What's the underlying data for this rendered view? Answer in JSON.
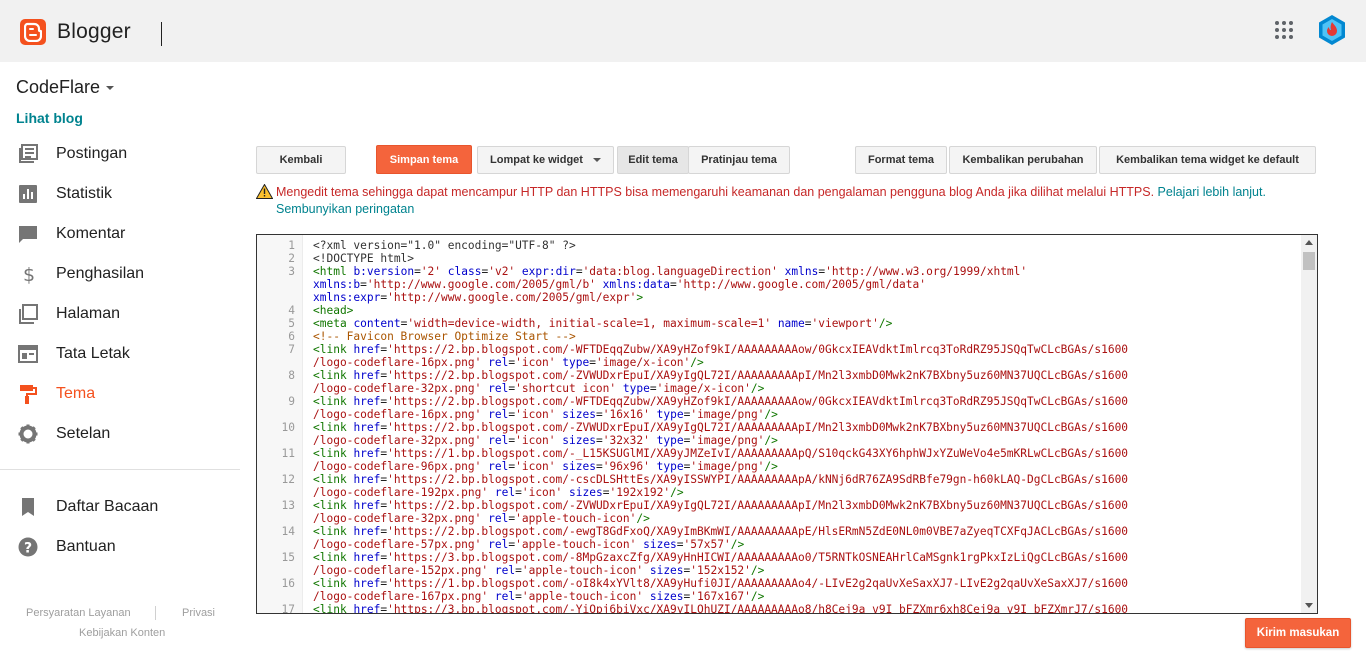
{
  "app": {
    "brand": "Blogger"
  },
  "sidebar": {
    "blog_name": "CodeFlare",
    "view_blog": "Lihat blog",
    "items": [
      {
        "label": "Postingan",
        "icon": "posts-icon"
      },
      {
        "label": "Statistik",
        "icon": "stats-icon"
      },
      {
        "label": "Komentar",
        "icon": "comments-icon"
      },
      {
        "label": "Penghasilan",
        "icon": "dollar-icon"
      },
      {
        "label": "Halaman",
        "icon": "pages-icon"
      },
      {
        "label": "Tata Letak",
        "icon": "layout-icon"
      },
      {
        "label": "Tema",
        "icon": "paint-roller-icon",
        "active": true
      },
      {
        "label": "Setelan",
        "icon": "gear-icon"
      }
    ],
    "items2": [
      {
        "label": "Daftar Bacaan",
        "icon": "bookmark-icon"
      },
      {
        "label": "Bantuan",
        "icon": "help-icon"
      }
    ],
    "footer": {
      "terms": "Persyaratan Layanan",
      "privacy": "Privasi",
      "content_policy": "Kebijakan Konten"
    }
  },
  "toolbar": {
    "back": "Kembali",
    "save": "Simpan tema",
    "jump": "Lompat ke widget",
    "edit": "Edit tema",
    "preview": "Pratinjau tema",
    "format": "Format tema",
    "revert": "Kembalikan perubahan",
    "revert_widgets": "Kembalikan tema widget ke default"
  },
  "warning": {
    "text": "Mengedit tema sehingga dapat mencampur HTTP dan HTTPS bisa memengaruhi keamanan dan pengalaman pengguna blog Anda jika dilihat melalui HTTPS. ",
    "learn_more": "Pelajari lebih lanjut.",
    "hide": "Sembunyikan peringatan"
  },
  "editor": {
    "lines": [
      {
        "n": "1",
        "html": "<span class=\"meta\">&lt;?xml version=\"1.0\" encoding=\"UTF-8\" ?&gt;</span>"
      },
      {
        "n": "2",
        "html": "<span class=\"meta\">&lt;!DOCTYPE html&gt;</span>"
      },
      {
        "n": "3",
        "html": "<span class=\"tag\">&lt;html</span> <span class=\"attr\">b:version</span>=<span class=\"str\">'2'</span> <span class=\"attr\">class</span>=<span class=\"str\">'v2'</span> <span class=\"attr\">expr:dir</span>=<span class=\"str\">'data:blog.languageDirection'</span> <span class=\"attr\">xmlns</span>=<span class=\"str\">'http://www.w3.org/1999/xhtml'</span>"
      },
      {
        "n": "",
        "html": "<span class=\"attr\">xmlns:b</span>=<span class=\"str\">'http://www.google.com/2005/gml/b'</span> <span class=\"attr\">xmlns:data</span>=<span class=\"str\">'http://www.google.com/2005/gml/data'</span>"
      },
      {
        "n": "",
        "html": "<span class=\"attr\">xmlns:expr</span>=<span class=\"str\">'http://www.google.com/2005/gml/expr'</span><span class=\"tag\">&gt;</span>"
      },
      {
        "n": "4",
        "html": "<span class=\"tag\">&lt;head&gt;</span>"
      },
      {
        "n": "5",
        "html": "<span class=\"tag\">&lt;meta</span> <span class=\"attr\">content</span>=<span class=\"str\">'width=device-width, initial-scale=1, maximum-scale=1'</span> <span class=\"attr\">name</span>=<span class=\"str\">'viewport'</span><span class=\"tag\">/&gt;</span>"
      },
      {
        "n": "6",
        "html": "<span class=\"cmt\">&lt;!-- Favicon Browser Optimize Start --&gt;</span>"
      },
      {
        "n": "7",
        "html": "<span class=\"tag\">&lt;link</span> <span class=\"attr\">href</span>=<span class=\"str\">'https://2.bp.blogspot.com/-WFTDEqqZubw/XA9yHZof9kI/AAAAAAAAAow/0GkcxIEAVdktImlrcq3ToRdRZ95JSQqTwCLcBGAs/s1600</span>"
      },
      {
        "n": "",
        "html": "<span class=\"str\">/logo-codeflare-16px.png'</span> <span class=\"attr\">rel</span>=<span class=\"str\">'icon'</span> <span class=\"attr\">type</span>=<span class=\"str\">'image/x-icon'</span><span class=\"tag\">/&gt;</span>"
      },
      {
        "n": "8",
        "html": "<span class=\"tag\">&lt;link</span> <span class=\"attr\">href</span>=<span class=\"str\">'https://2.bp.blogspot.com/-ZVWUDxrEpuI/XA9yIgQL72I/AAAAAAAAApI/Mn2l3xmbD0Mwk2nK7BXbny5uz60MN37UQCLcBGAs/s1600</span>"
      },
      {
        "n": "",
        "html": "<span class=\"str\">/logo-codeflare-32px.png'</span> <span class=\"attr\">rel</span>=<span class=\"str\">'shortcut icon'</span> <span class=\"attr\">type</span>=<span class=\"str\">'image/x-icon'</span><span class=\"tag\">/&gt;</span>"
      },
      {
        "n": "9",
        "html": "<span class=\"tag\">&lt;link</span> <span class=\"attr\">href</span>=<span class=\"str\">'https://2.bp.blogspot.com/-WFTDEqqZubw/XA9yHZof9kI/AAAAAAAAAow/0GkcxIEAVdktImlrcq3ToRdRZ95JSQqTwCLcBGAs/s1600</span>"
      },
      {
        "n": "",
        "html": "<span class=\"str\">/logo-codeflare-16px.png'</span> <span class=\"attr\">rel</span>=<span class=\"str\">'icon'</span> <span class=\"attr\">sizes</span>=<span class=\"str\">'16x16'</span> <span class=\"attr\">type</span>=<span class=\"str\">'image/png'</span><span class=\"tag\">/&gt;</span>"
      },
      {
        "n": "10",
        "html": "<span class=\"tag\">&lt;link</span> <span class=\"attr\">href</span>=<span class=\"str\">'https://2.bp.blogspot.com/-ZVWUDxrEpuI/XA9yIgQL72I/AAAAAAAAApI/Mn2l3xmbD0Mwk2nK7BXbny5uz60MN37UQCLcBGAs/s1600</span>"
      },
      {
        "n": "",
        "html": "<span class=\"str\">/logo-codeflare-32px.png'</span> <span class=\"attr\">rel</span>=<span class=\"str\">'icon'</span> <span class=\"attr\">sizes</span>=<span class=\"str\">'32x32'</span> <span class=\"attr\">type</span>=<span class=\"str\">'image/png'</span><span class=\"tag\">/&gt;</span>"
      },
      {
        "n": "11",
        "html": "<span class=\"tag\">&lt;link</span> <span class=\"attr\">href</span>=<span class=\"str\">'https://1.bp.blogspot.com/-_L15KSUGlMI/XA9yJMZeIvI/AAAAAAAAApQ/S10qckG43XY6hphWJxYZuWeVo4e5mKRLwCLcBGAs/s1600</span>"
      },
      {
        "n": "",
        "html": "<span class=\"str\">/logo-codeflare-96px.png'</span> <span class=\"attr\">rel</span>=<span class=\"str\">'icon'</span> <span class=\"attr\">sizes</span>=<span class=\"str\">'96x96'</span> <span class=\"attr\">type</span>=<span class=\"str\">'image/png'</span><span class=\"tag\">/&gt;</span>"
      },
      {
        "n": "12",
        "html": "<span class=\"tag\">&lt;link</span> <span class=\"attr\">href</span>=<span class=\"str\">'https://2.bp.blogspot.com/-cscDLSHttEs/XA9yISSWYPI/AAAAAAAAApA/kNNj6dR76ZA9SdRBfe79gn-h60kLAQ-DgCLcBGAs/s1600</span>"
      },
      {
        "n": "",
        "html": "<span class=\"str\">/logo-codeflare-192px.png'</span> <span class=\"attr\">rel</span>=<span class=\"str\">'icon'</span> <span class=\"attr\">sizes</span>=<span class=\"str\">'192x192'</span><span class=\"tag\">/&gt;</span>"
      },
      {
        "n": "13",
        "html": "<span class=\"tag\">&lt;link</span> <span class=\"attr\">href</span>=<span class=\"str\">'https://2.bp.blogspot.com/-ZVWUDxrEpuI/XA9yIgQL72I/AAAAAAAAApI/Mn2l3xmbD0Mwk2nK7BXbny5uz60MN37UQCLcBGAs/s1600</span>"
      },
      {
        "n": "",
        "html": "<span class=\"str\">/logo-codeflare-32px.png'</span> <span class=\"attr\">rel</span>=<span class=\"str\">'apple-touch-icon'</span><span class=\"tag\">/&gt;</span>"
      },
      {
        "n": "14",
        "html": "<span class=\"tag\">&lt;link</span> <span class=\"attr\">href</span>=<span class=\"str\">'https://2.bp.blogspot.com/-ewgT8GdFxoQ/XA9yImBKmWI/AAAAAAAAApE/HlsERmN5ZdE0NL0m0VBE7aZyeqTCXFqJACLcBGAs/s1600</span>"
      },
      {
        "n": "",
        "html": "<span class=\"str\">/logo-codeflare-57px.png'</span> <span class=\"attr\">rel</span>=<span class=\"str\">'apple-touch-icon'</span> <span class=\"attr\">sizes</span>=<span class=\"str\">'57x57'</span><span class=\"tag\">/&gt;</span>"
      },
      {
        "n": "15",
        "html": "<span class=\"tag\">&lt;link</span> <span class=\"attr\">href</span>=<span class=\"str\">'https://3.bp.blogspot.com/-8MpGzaxcZfg/XA9yHnHICWI/AAAAAAAAAo0/T5RNTkOSNEAHrlCaMSgnk1rgPkxIzLiQgCLcBGAs/s1600</span>"
      },
      {
        "n": "",
        "html": "<span class=\"str\">/logo-codeflare-152px.png'</span> <span class=\"attr\">rel</span>=<span class=\"str\">'apple-touch-icon'</span> <span class=\"attr\">sizes</span>=<span class=\"str\">'152x152'</span><span class=\"tag\">/&gt;</span>"
      },
      {
        "n": "16",
        "html": "<span class=\"tag\">&lt;link</span> <span class=\"attr\">href</span>=<span class=\"str\">'https://1.bp.blogspot.com/-oI8k4xYVlt8/XA9yHufi0JI/AAAAAAAAAo4/-LIvE2g2qaUvXeSaxXJ7-LIvE2g2qaUvXeSaxXJ7/s1600</span>"
      },
      {
        "n": "",
        "html": "<span class=\"str\">/logo-codeflare-167px.png'</span> <span class=\"attr\">rel</span>=<span class=\"str\">'apple-touch-icon'</span> <span class=\"attr\">sizes</span>=<span class=\"str\">'167x167'</span><span class=\"tag\">/&gt;</span>"
      },
      {
        "n": "17",
        "html": "<span class=\"tag\">&lt;link</span> <span class=\"attr\">href</span>=<span class=\"str\">'https://3.bp.blogspot.com/-YiOpj6biVxc/XA9yILOhUZI/AAAAAAAAAo8/h8Cej9a_v9I_bFZXmr6xh8Cej9a_v9I_bFZXmrJ7/s1600</span>"
      }
    ]
  },
  "send_feedback": "Kirim masukan"
}
